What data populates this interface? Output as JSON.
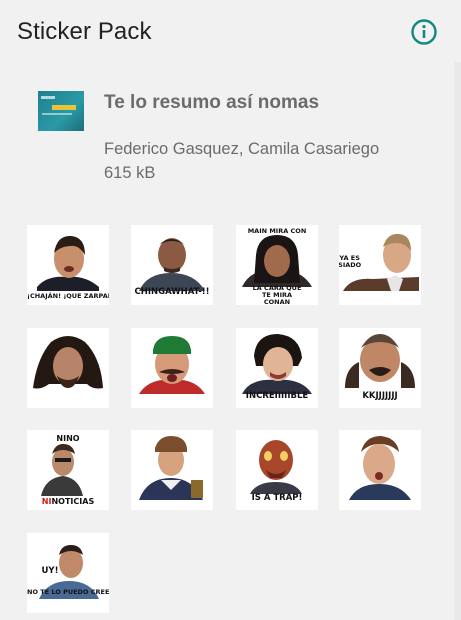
{
  "app_bar": {
    "title": "Sticker Pack",
    "info_icon": "info-circle-icon",
    "accent_color": "#0e8a7e"
  },
  "pack": {
    "name": "Te lo resumo así nomas",
    "authors": "Federico Gasquez, Camila Casariego",
    "size": "615 kB"
  },
  "stickers": [
    {
      "caption_top": "",
      "caption_bottom": "¡CHAJÁN! ¡QUE ZARPADO!"
    },
    {
      "caption_top": "",
      "caption_bottom": "CHINGAWHAT-!!"
    },
    {
      "caption_top": "MAIN MIRA CON",
      "caption_bottom": "LA CARA QUE TE MIRA CONAN"
    },
    {
      "caption_top": "ESTO YA ES DEMASIADO",
      "caption_bottom": ""
    },
    {
      "caption_top": "",
      "caption_bottom": ""
    },
    {
      "caption_top": "",
      "caption_bottom": ""
    },
    {
      "caption_top": "",
      "caption_bottom": "INCREIIIIIBLE"
    },
    {
      "caption_top": "",
      "caption_bottom": "KKJJJJJJJ"
    },
    {
      "caption_top": "NINO",
      "caption_bottom_red": "NI",
      "caption_bottom": "NOTICIAS"
    },
    {
      "caption_top": "",
      "caption_bottom": ""
    },
    {
      "caption_top": "",
      "caption_bottom": "IS A TRAP!"
    },
    {
      "caption_top": "",
      "caption_bottom": ""
    },
    {
      "caption_top": "UY!",
      "caption_bottom": "NO TE LO PUEDO CREER"
    }
  ]
}
